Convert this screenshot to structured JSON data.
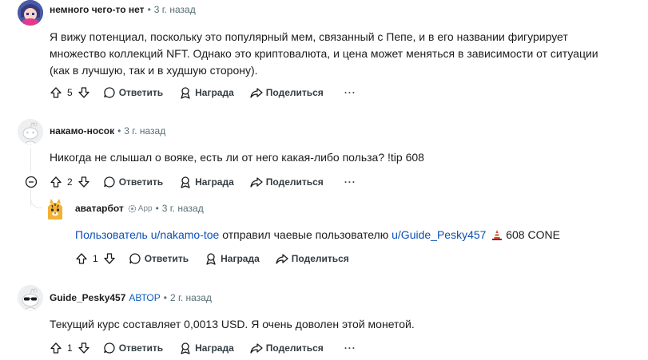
{
  "comments": [
    {
      "author": "немного чего-то нет",
      "time": "3 г. назад",
      "body": "Я вижу потенциал, поскольку это популярный мем, связанный с Пепе, и в его названии фигурирует множество коллекций NFT. Однако это криптовалюта, и цена может меняться в зависимости от ситуации (как в лучшую, так и в худшую сторону).",
      "votes": "5"
    },
    {
      "author": "накамо-носок",
      "time": "3 г. назад",
      "body": "Никогда не слышал о вояке, есть ли от него какая-либо польза? !tip 608",
      "votes": "2"
    },
    {
      "author": "аватарбот",
      "app_label": "App",
      "time": "3 г. назад",
      "body_link1": "Пользователь u/nakamo-toe",
      "body_mid": " отправил чаевые пользователю ",
      "body_link2": "u/Guide_Pesky457",
      "body_tail": " 608 CONE",
      "votes": "1"
    },
    {
      "author": "Guide_Pesky457",
      "op_label": "АВТОР",
      "time": "2 г. назад",
      "body": "Текущий курс составляет 0,0013 USD. Я очень доволен этой монетой.",
      "votes": "1"
    }
  ],
  "actions": {
    "reply": "Ответить",
    "award": "Награда",
    "share": "Поделиться",
    "more": "···"
  },
  "colors": {
    "link": "#0a4fb3",
    "meta": "#576f76",
    "thread_line": "#e5ebee"
  }
}
